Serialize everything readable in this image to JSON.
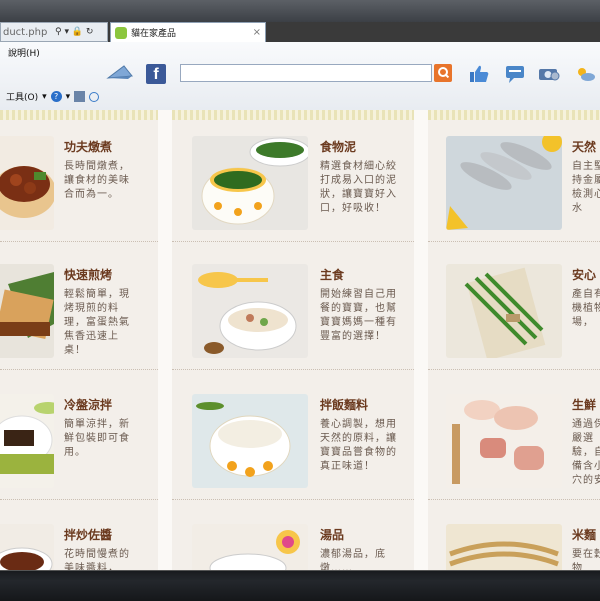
{
  "browser": {
    "address_text": "duct.php",
    "tab_title": "貓在家產品",
    "tab_close": "×",
    "menu_help": "說明(H)",
    "menu_tools": "工具(O)",
    "address_icons": "⚲ ▾ 🔒 ↻"
  },
  "toolbar_icons": [
    "pyramid-icon",
    "facebook-icon",
    "thumbs-up-icon",
    "chat-icon",
    "money-icon",
    "weather-icon"
  ],
  "facebook_letter": "f",
  "search": {
    "value": ""
  },
  "columns": [
    {
      "cards": [
        {
          "title": "功夫燉煮",
          "desc": "長時間燉煮，讓食材的美味合而為一。",
          "image": "stew-dish"
        },
        {
          "title": "快速煎烤",
          "desc": "輕鬆簡單，現烤現煎的料理，富蛋熱氣焦香迅速上桌！",
          "image": "grilled-fish"
        },
        {
          "title": "冷盤涼拌",
          "desc": "簡單涼拌，新鮮包裝即可食用。",
          "image": "cold-plate"
        },
        {
          "title": "拌炒佐醬",
          "desc": "花時間慢煮的美味醬料，",
          "image": "sauce-bowl"
        }
      ]
    },
    {
      "cards": [
        {
          "title": "食物泥",
          "desc": "精選食材細心絞打成易入口的泥狀，讓寶寶好入口，好吸收！",
          "image": "green-puree"
        },
        {
          "title": "主食",
          "desc": "開始練習自己用餐的寶寶，也幫寶寶媽媽一種有豐富的選擇！",
          "image": "porridge"
        },
        {
          "title": "拌飯麵料",
          "desc": "養心調製，想用天然的原料，讓寶寶品嘗食物的真正味道！",
          "image": "noodles"
        },
        {
          "title": "湯品",
          "desc": "濃郁湯品，底燉……",
          "image": "soup"
        }
      ]
    },
    {
      "cards": [
        {
          "title": "天然",
          "desc": "自主堅持金屬檢測心水",
          "image": "shrimp"
        },
        {
          "title": "安心",
          "desc": "產自有機植物場，",
          "image": "herbs"
        },
        {
          "title": "生鮮",
          "desc": "通過保嚴選驗，自備含小穴的安",
          "image": "raw-chicken"
        },
        {
          "title": "米麵",
          "desc": "要在穀物",
          "image": "grain"
        }
      ]
    }
  ]
}
